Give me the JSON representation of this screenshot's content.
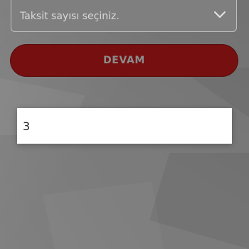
{
  "installments": {
    "select_placeholder": "Taksit sayısı seçiniz.",
    "options": [
      {
        "label": "3"
      }
    ]
  },
  "actions": {
    "continue_label": "DEVAM"
  },
  "theme": {
    "cta_color": "#760f0f",
    "overlay_color": "#7b7b7b"
  },
  "icons": {
    "dropdown": "chevron-down-icon"
  }
}
